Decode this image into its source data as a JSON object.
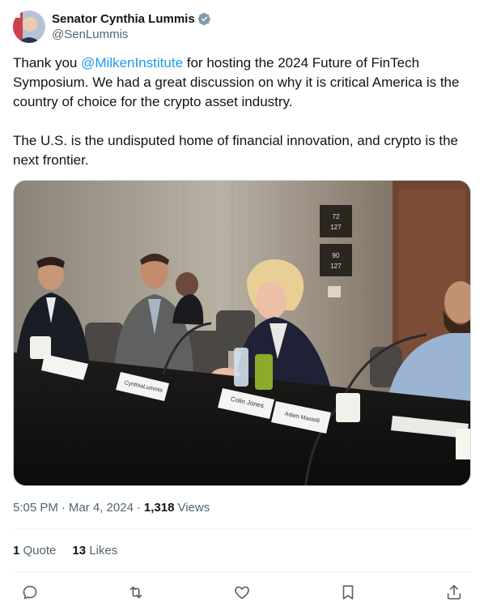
{
  "author": {
    "display_name": "Senator Cynthia Lummis",
    "handle": "@SenLummis",
    "verified_icon": "verified-badge-icon"
  },
  "tweet": {
    "p1_before": "Thank you ",
    "mention": "@MilkenInstitute",
    "p1_after": " for hosting the 2024 Future of FinTech Symposium. We had a great discussion on why it is critical America is the country of choice for the crypto asset industry.",
    "p2": "The U.S. is the undisputed home of financial innovation, and crypto is the next frontier."
  },
  "media": {
    "sign_top": "72",
    "sign_top_room": "127",
    "sign_bottom": "90",
    "sign_bottom_room": "127",
    "place_card_1": "Colin Jones",
    "place_card_2": "Adam Mastelli",
    "place_card_3": "CynthiaLummis"
  },
  "meta": {
    "time": "5:05 PM",
    "separator": "·",
    "date": "Mar 4, 2024",
    "views_count": "1,318",
    "views_label": "Views"
  },
  "stats": {
    "quotes_count": "1",
    "quotes_label": "Quote",
    "likes_count": "13",
    "likes_label": "Likes"
  },
  "actions": [
    "reply-icon",
    "retweet-icon",
    "like-icon",
    "bookmark-icon",
    "share-icon"
  ],
  "colors": {
    "accent": "#1d9bf0",
    "text": "#0f1419",
    "secondary": "#536471",
    "icon": "#536471"
  }
}
